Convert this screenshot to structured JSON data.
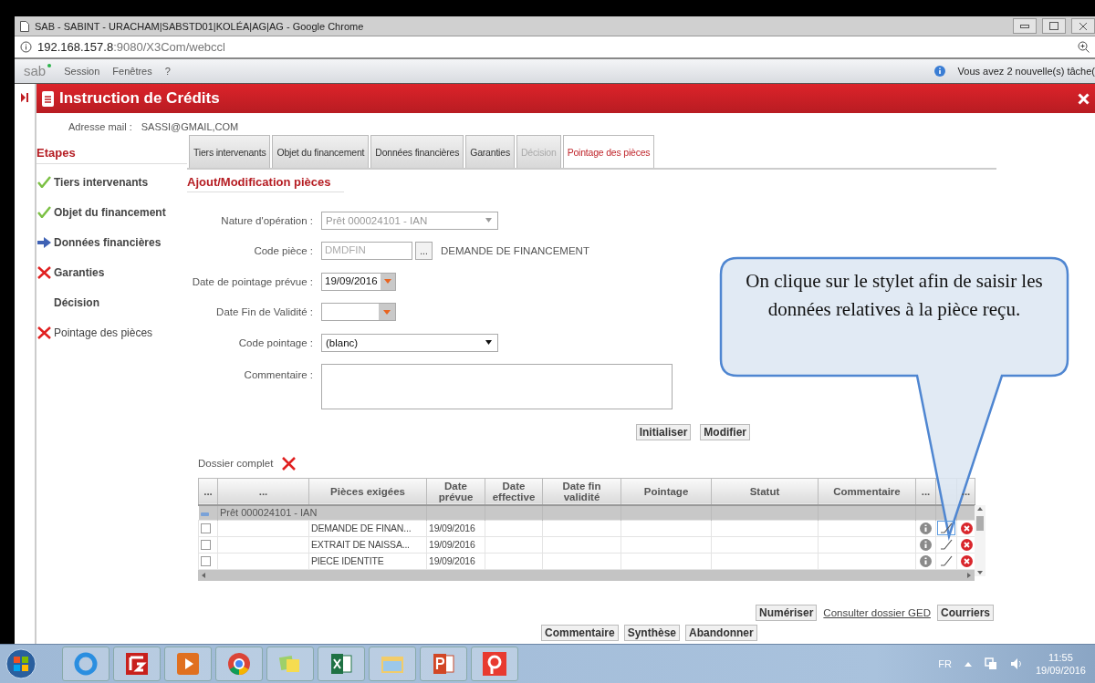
{
  "browser": {
    "title": "SAB - SABINT - URACHAM|SABSTD01|KOLÉA|AG|AG - Google Chrome",
    "url_host": "192.168.157.8",
    "url_path": ":9080/X3Com/webccl"
  },
  "app_menu": {
    "logo": "sab",
    "items": [
      "Session",
      "Fenêtres",
      "?"
    ],
    "notice": "Vous avez 2 nouvelle(s) tâche("
  },
  "header": {
    "title": "Instruction de Crédits"
  },
  "email": {
    "label": "Adresse mail :",
    "value": "SASSI@GMAIL,COM"
  },
  "steps": {
    "title": "Etapes",
    "items": [
      {
        "label": "Tiers intervenants",
        "kind": "done"
      },
      {
        "label": "Objet du financement",
        "kind": "done"
      },
      {
        "label": "Données financières",
        "kind": "current"
      },
      {
        "label": "Garanties",
        "kind": "missing"
      },
      {
        "label": "Décision",
        "kind": "none"
      },
      {
        "label": "Pointage des pièces",
        "kind": "missing"
      }
    ]
  },
  "tabs": [
    {
      "label": "Tiers intervenants",
      "selected": false,
      "disabled": false
    },
    {
      "label": "Objet du financement",
      "selected": false,
      "disabled": false
    },
    {
      "label": "Données financières",
      "selected": false,
      "disabled": false
    },
    {
      "label": "Garanties",
      "selected": false,
      "disabled": false
    },
    {
      "label": "Décision",
      "selected": false,
      "disabled": true
    },
    {
      "label": "Pointage des pièces",
      "selected": true,
      "disabled": false
    }
  ],
  "section_title": "Ajout/Modification pièces",
  "form": [
    {
      "kind": "select",
      "label": "Nature d'opération :",
      "value": "Prêt 000024101 - IAN",
      "disabled": true
    },
    {
      "kind": "code",
      "label": "Code pièce :",
      "value": "DMDFIN",
      "disabled": true,
      "button": "...",
      "description": "DEMANDE DE FINANCEMENT"
    },
    {
      "kind": "date",
      "label": "Date de pointage prévue :",
      "value": "19/09/2016"
    },
    {
      "kind": "date",
      "label": "Date Fin de Validité :"
    },
    {
      "kind": "select",
      "label": "Code pointage :",
      "value": "(blanc)",
      "disabled": false
    },
    {
      "kind": "textarea",
      "label": "Commentaire :"
    }
  ],
  "form_actions": [
    "Initialiser",
    "Modifier"
  ],
  "dossier": {
    "label": "Dossier complet",
    "complete": false
  },
  "table": {
    "columns": [
      "...",
      "...",
      "Pièces exigées",
      "Date prévue",
      "Date effective",
      "Date fin validité",
      "Pointage",
      "Statut",
      "Commentaire"
    ],
    "action_columns": [
      "...",
      "..."
    ],
    "group": {
      "label": "Prêt 000024101 - IAN",
      "expanded": true
    },
    "rows": [
      {
        "checked": false,
        "piece": "DEMANDE DE FINAN...",
        "date_prevue": "19/09/2016",
        "edit_selected": true
      },
      {
        "checked": false,
        "piece": "EXTRAIT DE NAISSA...",
        "date_prevue": "19/09/2016",
        "edit_selected": false
      },
      {
        "checked": false,
        "piece": "PIECE IDENTITE",
        "date_prevue": "19/09/2016",
        "edit_selected": false
      }
    ]
  },
  "bottom_actions": [
    {
      "kind": "button",
      "label": "Numériser"
    },
    {
      "kind": "link",
      "label": "Consulter dossier GED"
    },
    {
      "kind": "button",
      "label": "Courriers"
    }
  ],
  "footer_buttons": [
    "Commentaire",
    "Synthèse",
    "Abandonner"
  ],
  "callout": {
    "text": "On clique sur le stylet afin de saisir les données relatives à la pièce reçu."
  },
  "taskbar": {
    "language": "FR",
    "time": "11:55",
    "date": "19/09/2016"
  }
}
